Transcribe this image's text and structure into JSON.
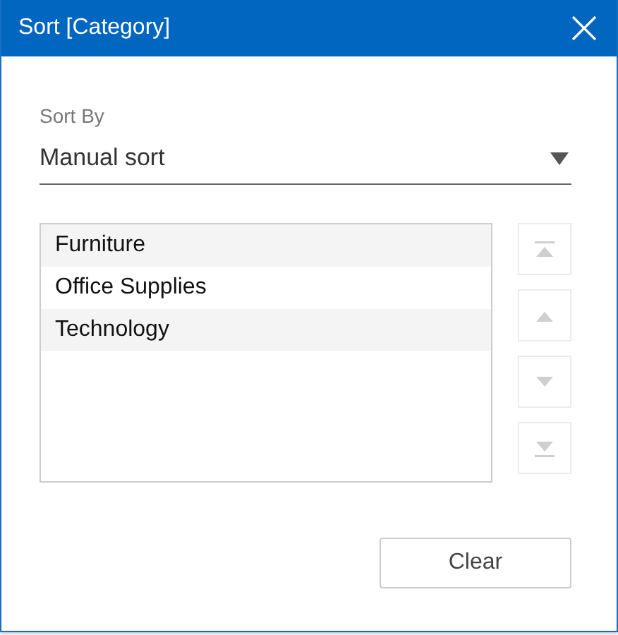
{
  "window": {
    "title": "Sort [Category]"
  },
  "sort_by": {
    "label": "Sort By",
    "value": "Manual sort"
  },
  "items": [
    {
      "label": "Furniture"
    },
    {
      "label": "Office Supplies"
    },
    {
      "label": "Technology"
    }
  ],
  "move_buttons": [
    {
      "kind": "top",
      "disabled": true
    },
    {
      "kind": "up",
      "disabled": true
    },
    {
      "kind": "down",
      "disabled": true
    },
    {
      "kind": "bottom",
      "disabled": true
    }
  ],
  "buttons": [
    {
      "label": "Clear"
    }
  ]
}
